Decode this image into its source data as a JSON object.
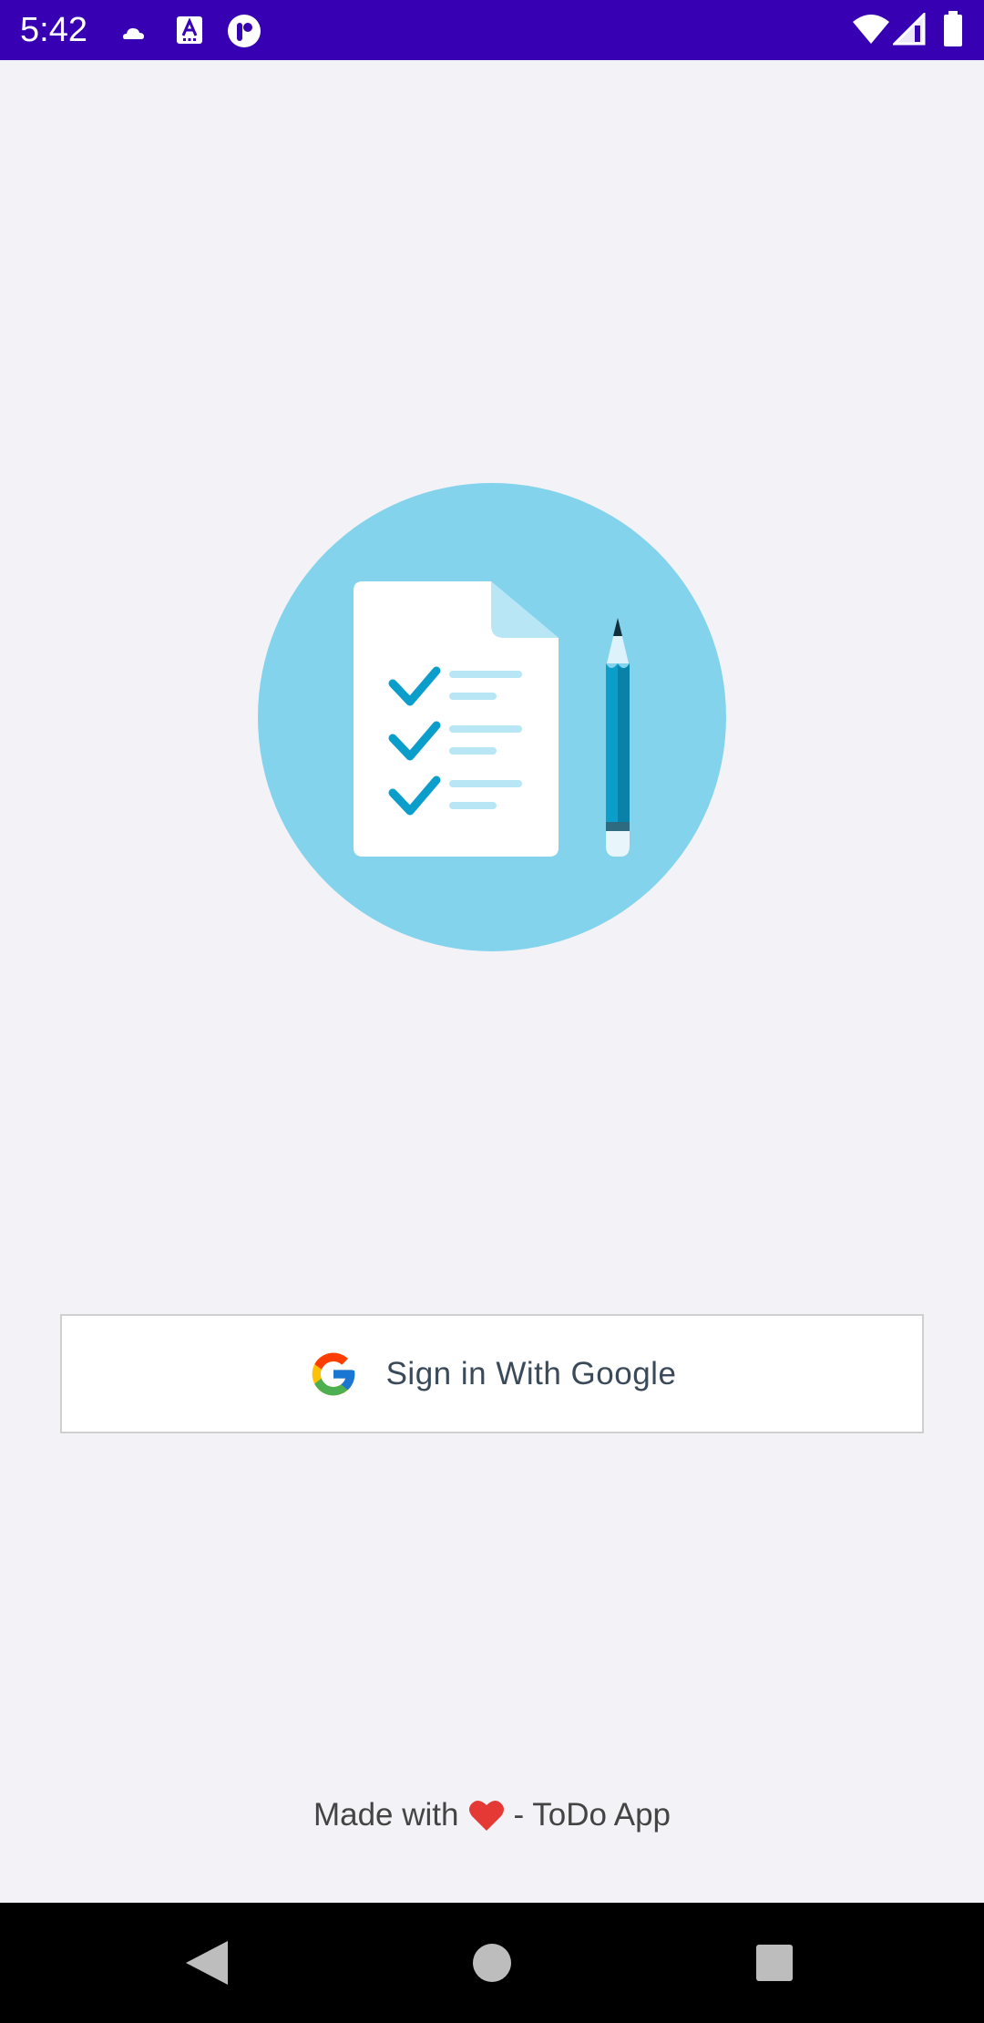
{
  "status_bar": {
    "time": "5:42",
    "icons": [
      "cloud-icon",
      "a-notification-icon",
      "p-notification-icon",
      "wifi-icon",
      "signal-icon",
      "battery-icon"
    ],
    "background": "#3700B3"
  },
  "illustration": {
    "icon": "todo-checklist-pencil-icon",
    "circle_color": "#84D3ED",
    "check_color": "#0B9ECB"
  },
  "sign_in": {
    "label": "Sign in With Google",
    "icon": "google-logo-icon"
  },
  "footer": {
    "prefix": "Made with",
    "icon": "heart-icon",
    "suffix": "- ToDo App"
  },
  "nav_bar": {
    "buttons": [
      "back-icon",
      "home-icon",
      "recents-icon"
    ]
  },
  "colors": {
    "background": "#F3F3F7",
    "button_border": "#CFCFCF",
    "button_text": "#3A4A5A",
    "heart": "#E53935"
  }
}
